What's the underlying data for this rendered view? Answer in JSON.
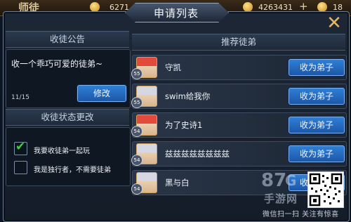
{
  "hud": {
    "title": "师徒",
    "stat1": "6271",
    "stat2": "4263431",
    "stat3": "18",
    "plus": "+"
  },
  "dialog": {
    "title": "申请列表",
    "close_glyph": "✕"
  },
  "left": {
    "notice_header": "收徒公告",
    "notice_text": "收一个乖巧可爱的徒弟~",
    "notice_count": "11/15",
    "edit_button": "修改",
    "status_header": "收徒状态更改",
    "options": [
      {
        "label": "我要收徒弟一起玩",
        "checked": true
      },
      {
        "label": "我是独行者，不需要徒弟",
        "checked": false
      }
    ]
  },
  "right": {
    "header": "推荐徒弟",
    "rows": [
      {
        "level": "55",
        "name": "守凯",
        "button": "收为弟子",
        "hair": "#e24a3b"
      },
      {
        "level": "55",
        "name": "swim给我你",
        "button": "收为弟子",
        "hair": "#d7d7e4"
      },
      {
        "level": "54",
        "name": "为了史诗1",
        "button": "收为弟子",
        "hair": "#e24a3b"
      },
      {
        "level": "54",
        "name": "兹兹兹兹兹兹兹兹",
        "button": "收为弟子",
        "hair": "#d7d7e4"
      },
      {
        "level": "54",
        "name": "黑与白",
        "button": "收为弟子",
        "hair": "#d7d7e4"
      }
    ]
  },
  "watermark": {
    "brand_num": "87",
    "brand_letter": "G",
    "brand_text": "手游网",
    "footer": "微信扫一扫 关注有惊喜"
  },
  "colors": {
    "accent_blue": "#2f7fd6",
    "check_green": "#39d23a",
    "close_gold": "#e3b762"
  }
}
